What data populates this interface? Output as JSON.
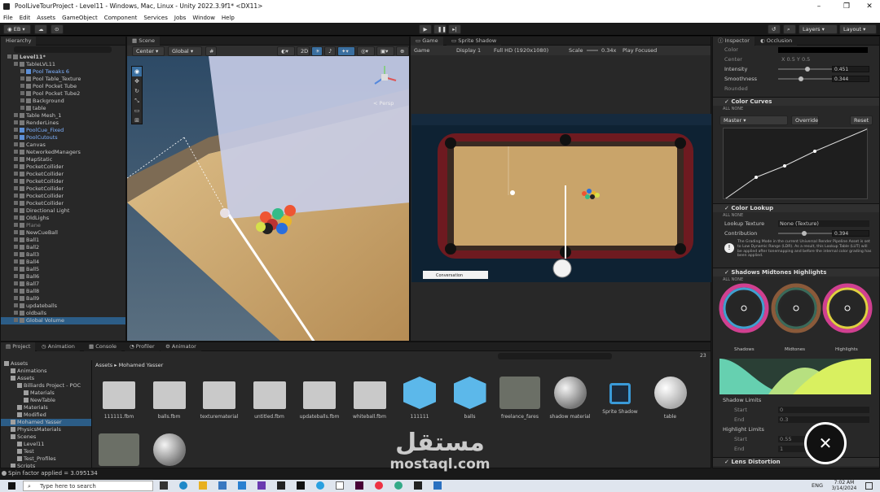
{
  "window": {
    "title": "PoolLiveTourProject - Level11 - Windows, Mac, Linux - Unity 2022.3.9f1* <DX11>"
  },
  "menu": [
    "File",
    "Edit",
    "Assets",
    "GameObject",
    "Component",
    "Services",
    "Jobs",
    "Window",
    "Help"
  ],
  "toolbar": {
    "account": "EB",
    "layers": "Layers",
    "layout": "Layout"
  },
  "hierarchy": {
    "tab": "Hierarchy",
    "items": [
      {
        "label": "Level11*",
        "depth": 0,
        "style": "bold"
      },
      {
        "label": "TableLVL11",
        "depth": 1,
        "style": ""
      },
      {
        "label": "Pool Tweaks 6",
        "depth": 2,
        "style": "blue"
      },
      {
        "label": "Pool Table_Texture",
        "depth": 2,
        "style": ""
      },
      {
        "label": "Pool Pocket Tube",
        "depth": 2,
        "style": ""
      },
      {
        "label": "Pool Pocket Tube2",
        "depth": 2,
        "style": ""
      },
      {
        "label": "Background",
        "depth": 2,
        "style": ""
      },
      {
        "label": "table",
        "depth": 2,
        "style": ""
      },
      {
        "label": "Table Mesh_1",
        "depth": 1,
        "style": ""
      },
      {
        "label": "RenderLines",
        "depth": 1,
        "style": ""
      },
      {
        "label": "PoolCue_Fixed",
        "depth": 1,
        "style": "blue"
      },
      {
        "label": "PoolCutouts",
        "depth": 1,
        "style": "blue"
      },
      {
        "label": "Canvas",
        "depth": 1,
        "style": ""
      },
      {
        "label": "NetworkedManagers",
        "depth": 1,
        "style": ""
      },
      {
        "label": "MapStatic",
        "depth": 1,
        "style": ""
      },
      {
        "label": "PocketCollider",
        "depth": 1,
        "style": ""
      },
      {
        "label": "PocketCollider",
        "depth": 1,
        "style": ""
      },
      {
        "label": "PocketCollider",
        "depth": 1,
        "style": ""
      },
      {
        "label": "PocketCollider",
        "depth": 1,
        "style": ""
      },
      {
        "label": "PocketCollider",
        "depth": 1,
        "style": ""
      },
      {
        "label": "PocketCollider",
        "depth": 1,
        "style": ""
      },
      {
        "label": "Directional Light",
        "depth": 1,
        "style": ""
      },
      {
        "label": "OldLighs",
        "depth": 1,
        "style": ""
      },
      {
        "label": "Plane",
        "depth": 1,
        "style": "dim"
      },
      {
        "label": "NewCueBall",
        "depth": 1,
        "style": ""
      },
      {
        "label": "Ball1",
        "depth": 1,
        "style": ""
      },
      {
        "label": "Ball2",
        "depth": 1,
        "style": ""
      },
      {
        "label": "Ball3",
        "depth": 1,
        "style": ""
      },
      {
        "label": "Ball4",
        "depth": 1,
        "style": ""
      },
      {
        "label": "Ball5",
        "depth": 1,
        "style": ""
      },
      {
        "label": "Ball6",
        "depth": 1,
        "style": ""
      },
      {
        "label": "Ball7",
        "depth": 1,
        "style": ""
      },
      {
        "label": "Ball8",
        "depth": 1,
        "style": ""
      },
      {
        "label": "Ball9",
        "depth": 1,
        "style": ""
      },
      {
        "label": "updateballs",
        "depth": 1,
        "style": ""
      },
      {
        "label": "oldballs",
        "depth": 1,
        "style": ""
      },
      {
        "label": "Global Volume",
        "depth": 1,
        "style": "selected"
      }
    ]
  },
  "scene": {
    "tab": "Scene",
    "pivot": "Center",
    "space": "Global",
    "mode2d": "2D",
    "persp": "< Persp"
  },
  "game": {
    "tab": "Game",
    "tab2": "Sprite Shadow",
    "display": "Game",
    "display_num": "Display 1",
    "resolution": "Full HD (1920x1080)",
    "scale_label": "Scale",
    "scale": "0.34x",
    "focus": "Play Focused",
    "conversation": "Conversation"
  },
  "inspector": {
    "tab": "Inspector",
    "tab2": "Occlusion",
    "rows_top": [
      {
        "label": "Color",
        "value": ""
      },
      {
        "label": "Center",
        "value": "X 0.5    Y 0.5"
      },
      {
        "label": "Intensity",
        "value": "0.451"
      },
      {
        "label": "Smoothness",
        "value": "0.344"
      },
      {
        "label": "Rounded",
        "value": ""
      }
    ],
    "color_curves": {
      "title": "Color Curves",
      "all": "ALL",
      "none": "NONE",
      "channel": "Master",
      "override": "Override",
      "reset": "Reset"
    },
    "color_lookup": {
      "title": "Color Lookup",
      "all": "ALL",
      "none": "NONE",
      "texture_label": "Lookup Texture",
      "texture_value": "None (Texture)",
      "contribution_label": "Contribution",
      "contribution": "0.394",
      "warning": "The Grading Mode in the current Universal Render Pipeline Asset is set to Low Dynamic Range (LDR). As a result, this Lookup Table (LUT) will be applied after tonemapping and before the internal color grading has been applied."
    },
    "smh": {
      "title": "Shadows Midtones Highlights",
      "all": "ALL",
      "none": "NONE",
      "wheels": [
        "Shadows",
        "Midtones",
        "Highlights"
      ]
    },
    "shadow_limits": {
      "title": "Shadow Limits",
      "start_label": "Start",
      "start": "0",
      "end_label": "End",
      "end": "0.3"
    },
    "highlight_limits": {
      "title": "Highlight Limits",
      "start_label": "Start",
      "start": "0.55",
      "end_label": "End",
      "end": "1"
    },
    "lens": {
      "title": "Lens Distortion"
    }
  },
  "project": {
    "tabs": [
      "Project",
      "Animation",
      "Console",
      "Profiler",
      "Animator"
    ],
    "breadcrumb": [
      "Assets",
      "Mohamed Yasser"
    ],
    "count": "23",
    "tree": [
      {
        "label": "Assets",
        "depth": 0
      },
      {
        "label": "Animations",
        "depth": 1
      },
      {
        "label": "Assets",
        "depth": 1
      },
      {
        "label": "Billiards Project - POC",
        "depth": 2
      },
      {
        "label": "Materials",
        "depth": 3
      },
      {
        "label": "NewTable",
        "depth": 3
      },
      {
        "label": "Materials",
        "depth": 2
      },
      {
        "label": "Modified",
        "depth": 2
      },
      {
        "label": "Mohamed Yasser",
        "depth": 1
      },
      {
        "label": "PhysicsMaterials",
        "depth": 1
      },
      {
        "label": "Scenes",
        "depth": 1
      },
      {
        "label": "Level11",
        "depth": 2
      },
      {
        "label": "Test",
        "depth": 2
      },
      {
        "label": "Test_Profiles",
        "depth": 2
      },
      {
        "label": "Scripts",
        "depth": 1
      }
    ],
    "assets": [
      {
        "label": "111111.fbm",
        "kind": "folder"
      },
      {
        "label": "balls.fbm",
        "kind": "folder"
      },
      {
        "label": "texturematerial",
        "kind": "folder"
      },
      {
        "label": "untitled.fbm",
        "kind": "folder"
      },
      {
        "label": "updateballs.fbm",
        "kind": "folder"
      },
      {
        "label": "whiteball.fbm",
        "kind": "folder"
      },
      {
        "label": "111111",
        "kind": "model"
      },
      {
        "label": "balls",
        "kind": "model"
      },
      {
        "label": "freelance_fares",
        "kind": "image"
      },
      {
        "label": "shadow material",
        "kind": "sphere"
      },
      {
        "label": "Sprite Shadow",
        "kind": "sprite"
      },
      {
        "label": "table",
        "kind": "sphere2"
      }
    ]
  },
  "status": {
    "text": "Spin factor applied = 3.095134"
  },
  "watermark": {
    "arabic": "مستقل",
    "latin": "mostaql.com"
  },
  "taskbar": {
    "search": "Type here to search",
    "lang": "ENG",
    "time": "7:02 AM",
    "date": "3/14/2024"
  },
  "colors": {
    "accent": "#2c5d87",
    "felt": "#c9a46a",
    "rail": "#7a1c22",
    "panel": "#282828"
  }
}
